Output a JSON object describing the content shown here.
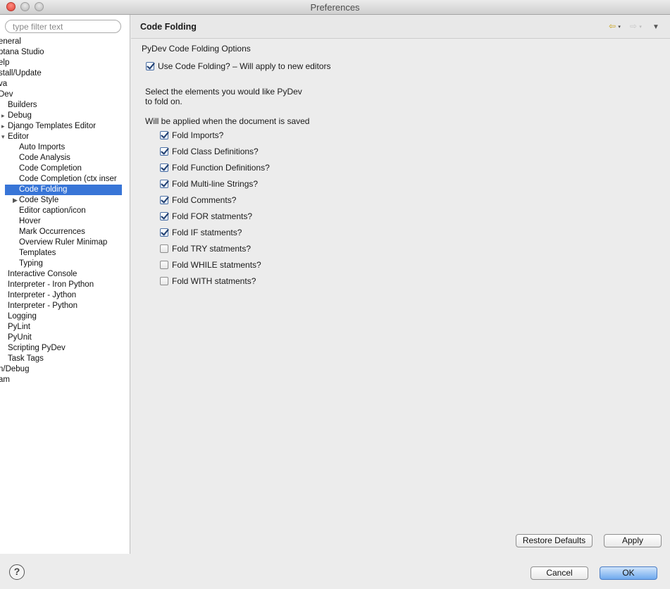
{
  "window": {
    "title": "Preferences"
  },
  "sidebar": {
    "filter_placeholder": "type filter text",
    "items": [
      {
        "label": "eneral",
        "indent": 0
      },
      {
        "label": "ptana Studio",
        "indent": 0
      },
      {
        "label": "elp",
        "indent": 0
      },
      {
        "label": "stall/Update",
        "indent": 0
      },
      {
        "label": "va",
        "indent": 0
      },
      {
        "label": "Dev",
        "indent": 0
      },
      {
        "label": "Builders",
        "indent": 1
      },
      {
        "label": "Debug",
        "indent": 1,
        "twisty": "▸"
      },
      {
        "label": "Django Templates Editor",
        "indent": 1,
        "twisty": "▸"
      },
      {
        "label": "Editor",
        "indent": 1,
        "twisty": "▾"
      },
      {
        "label": "Auto Imports",
        "indent": 2
      },
      {
        "label": "Code Analysis",
        "indent": 2
      },
      {
        "label": "Code Completion",
        "indent": 2
      },
      {
        "label": "Code Completion (ctx inser",
        "indent": 2
      },
      {
        "label": "Code Folding",
        "indent": 2,
        "selected": true
      },
      {
        "label": "Code Style",
        "indent": 2,
        "twisty": "▶"
      },
      {
        "label": "Editor caption/icon",
        "indent": 2
      },
      {
        "label": "Hover",
        "indent": 2
      },
      {
        "label": "Mark Occurrences",
        "indent": 2
      },
      {
        "label": "Overview Ruler Minimap",
        "indent": 2
      },
      {
        "label": "Templates",
        "indent": 2
      },
      {
        "label": "Typing",
        "indent": 2
      },
      {
        "label": "Interactive Console",
        "indent": 1
      },
      {
        "label": "Interpreter - Iron Python",
        "indent": 1
      },
      {
        "label": "Interpreter - Jython",
        "indent": 1
      },
      {
        "label": "Interpreter - Python",
        "indent": 1
      },
      {
        "label": "Logging",
        "indent": 1
      },
      {
        "label": "PyLint",
        "indent": 1
      },
      {
        "label": "PyUnit",
        "indent": 1
      },
      {
        "label": "Scripting PyDev",
        "indent": 1
      },
      {
        "label": "Task Tags",
        "indent": 1
      },
      {
        "label": "n/Debug",
        "indent": 0
      },
      {
        "label": "am",
        "indent": 0
      }
    ]
  },
  "header": {
    "title": "Code Folding",
    "back_glyph": "⇦",
    "forward_glyph": "⇨",
    "caret_glyph": "▾",
    "menu_glyph": "▼"
  },
  "main": {
    "section_title": "PyDev Code Folding Options",
    "use_folding": {
      "label": "Use Code Folding?  –  Will apply to new editors",
      "checked": true
    },
    "description_line1": "Select the elements you would like PyDev",
    "description_line2": "to fold on.",
    "applied_note": "Will be applied when the document is saved",
    "options": [
      {
        "label": "Fold Imports?",
        "checked": true
      },
      {
        "label": "Fold Class Definitions?",
        "checked": true
      },
      {
        "label": "Fold Function Definitions?",
        "checked": true
      },
      {
        "label": "Fold Multi-line Strings?",
        "checked": true
      },
      {
        "label": "Fold Comments?",
        "checked": true
      },
      {
        "label": "Fold FOR statments?",
        "checked": true
      },
      {
        "label": "Fold IF statments?",
        "checked": true
      },
      {
        "label": "Fold TRY statments?",
        "checked": false
      },
      {
        "label": "Fold WHILE statments?",
        "checked": false
      },
      {
        "label": "Fold WITH statments?",
        "checked": false
      }
    ],
    "restore_defaults_label": "Restore Defaults",
    "apply_label": "Apply"
  },
  "footer": {
    "help_glyph": "?",
    "cancel_label": "Cancel",
    "ok_label": "OK"
  }
}
